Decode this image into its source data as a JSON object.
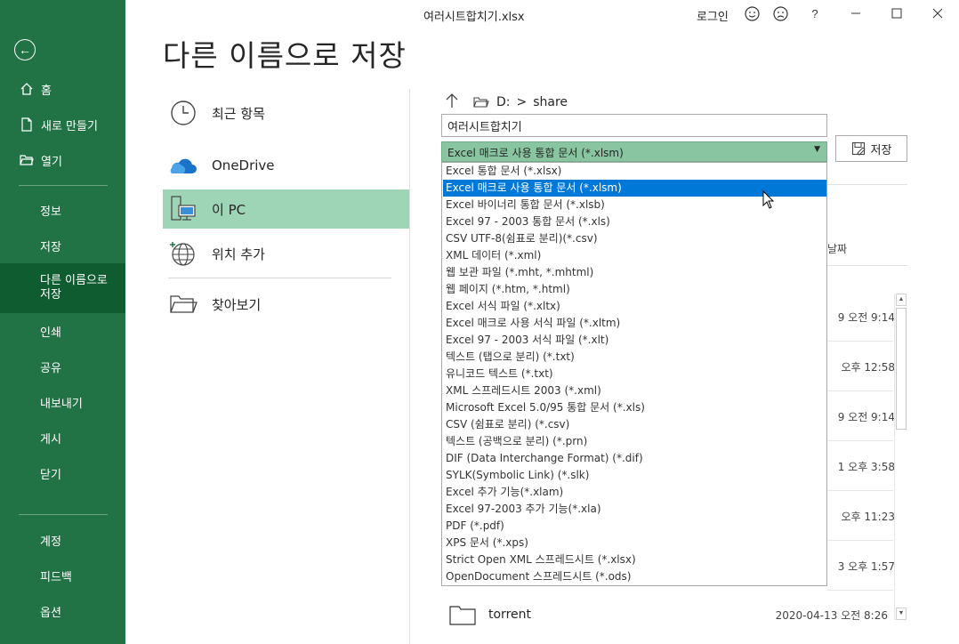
{
  "window": {
    "title": "여러시트합치기.xlsx",
    "signin": "로그인",
    "help": "?"
  },
  "sidebar": {
    "back": "back",
    "items": [
      {
        "label": "홈",
        "icon": "home-icon"
      },
      {
        "label": "새로 만들기",
        "icon": "new-file-icon"
      },
      {
        "label": "열기",
        "icon": "open-folder-icon"
      },
      {
        "label": "정보"
      },
      {
        "label": "저장"
      },
      {
        "label": "다른 이름으로\n저장",
        "selected": true
      },
      {
        "label": "인쇄"
      },
      {
        "label": "공유"
      },
      {
        "label": "내보내기"
      },
      {
        "label": "게시"
      },
      {
        "label": "닫기"
      },
      {
        "label": "계정"
      },
      {
        "label": "피드백"
      },
      {
        "label": "옵션"
      }
    ]
  },
  "page_title": "다른 이름으로 저장",
  "locations": [
    {
      "label": "최근 항목",
      "icon": "clock-icon"
    },
    {
      "label": "OneDrive",
      "icon": "cloud-icon"
    },
    {
      "label": "이 PC",
      "icon": "computer-icon",
      "selected": true
    },
    {
      "label": "위치 추가",
      "icon": "globe-icon"
    },
    {
      "label": "찾아보기",
      "icon": "folder-icon"
    }
  ],
  "path": {
    "drive": "D:",
    "separator": ">",
    "folder": "share"
  },
  "filename": "여러시트합치기",
  "filetype": {
    "selected": "Excel 매크로 사용 통합 문서 (*.xlsm)",
    "options": [
      "Excel 통합 문서 (*.xlsx)",
      "Excel 매크로 사용 통합 문서 (*.xlsm)",
      "Excel 바이너리 통합 문서 (*.xlsb)",
      "Excel 97 - 2003 통합 문서 (*.xls)",
      "CSV UTF-8(쉼표로 분리)(*.csv)",
      "XML 데이터 (*.xml)",
      "웹 보관 파일 (*.mht, *.mhtml)",
      "웹 페이지 (*.htm, *.html)",
      "Excel 서식 파일 (*.xltx)",
      "Excel 매크로 사용 서식 파일 (*.xltm)",
      "Excel 97 - 2003 서식 파일 (*.xlt)",
      "텍스트 (탭으로 분리) (*.txt)",
      "유니코드 텍스트 (*.txt)",
      "XML 스프레드시트 2003 (*.xml)",
      "Microsoft Excel 5.0/95 통합 문서 (*.xls)",
      "CSV (쉼표로 분리) (*.csv)",
      "텍스트 (공백으로 분리) (*.prn)",
      "DIF (Data Interchange Format) (*.dif)",
      "SYLK(Symbolic Link) (*.slk)",
      "Excel 추가 기능(*.xlam)",
      "Excel 97-2003 추가 기능(*.xla)",
      "PDF (*.pdf)",
      "XPS 문서 (*.xps)",
      "Strict Open XML 스프레드시트 (*.xlsx)",
      "OpenDocument 스프레드시트 (*.ods)"
    ],
    "highlighted_index": 1
  },
  "save_button": "저장",
  "date_header": "날짜",
  "dates": [
    "9 오전 9:14",
    "오후 12:58",
    "9 오전 9:14",
    "1 오후 3:58",
    "오후 11:23",
    "3 오후 1:57"
  ],
  "folder_row": {
    "name": "torrent",
    "date": "2020-04-13 오전 8:26"
  },
  "colors": {
    "accent": "#217346",
    "selected_nav": "#0e5c2f",
    "selected_location": "#9fd5b7",
    "dropdown_highlight": "#0078d7"
  }
}
